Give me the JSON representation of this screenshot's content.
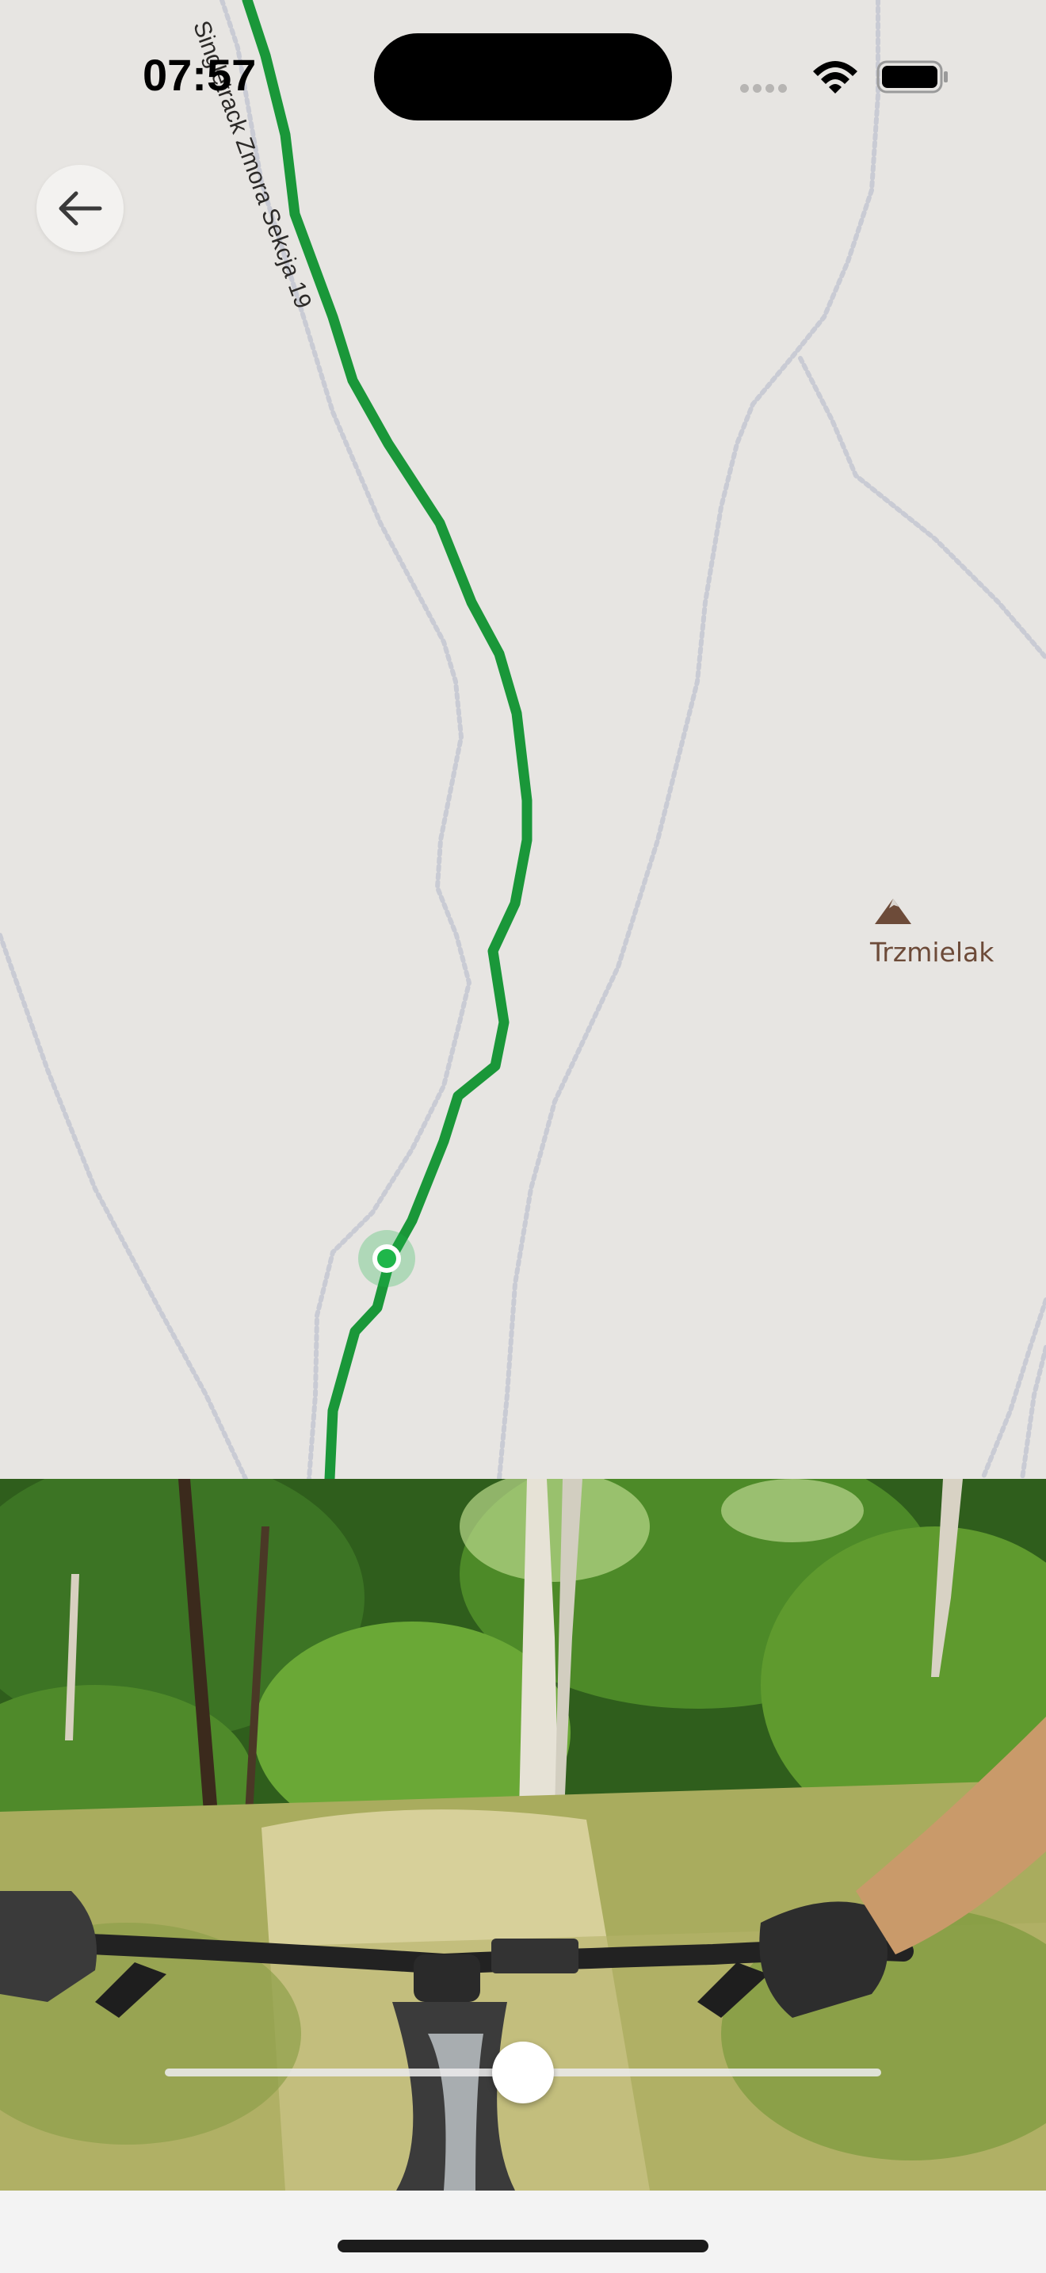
{
  "status_bar": {
    "time": "07:57"
  },
  "map": {
    "trail_label": "Singletrack Zmora Sekcja 19",
    "peak_label": "Trzmielak",
    "route_color": "#1a9739",
    "path_color": "#c9cbd4",
    "peak_icon_color": "#6d4b39",
    "position_marker_color": "#1fb64a"
  },
  "controls": {
    "back_icon": "arrow-left-icon"
  },
  "video": {
    "progress_fraction": 0.5
  }
}
